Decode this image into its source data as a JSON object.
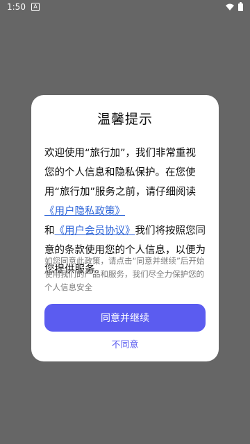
{
  "status_bar": {
    "time": "1:50",
    "badge": "A",
    "icons": [
      "wifi-icon",
      "battery-icon"
    ]
  },
  "dialog": {
    "title": "温馨提示",
    "body": {
      "part1": "欢迎使用“旅行加”，我们非常重视您的个人信息和隐私保护。在您使用“旅行加”服务之前，请仔细阅读",
      "privacy_link": "《用户隐私政策》",
      "and": "和",
      "member_link": "《用户会员协议》",
      "part2": "我们将按照您同意的条款使用您的个人信息，以便为您提供服务。"
    },
    "note": "如您同意此政策，请点击“同意并继续”后开始使用我们的产品和服务，我们尽全力保护您的个人信息安全",
    "agree_label": "同意并继续",
    "disagree_label": "不同意"
  },
  "colors": {
    "overlay": "#666666",
    "accent": "#5b5cf0",
    "link": "#2f66d9"
  }
}
